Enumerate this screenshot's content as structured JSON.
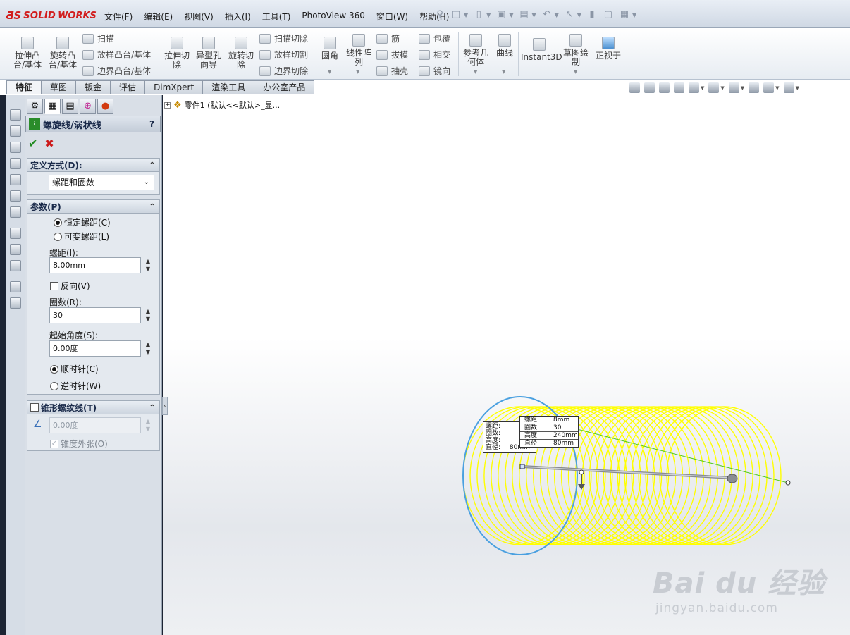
{
  "app": {
    "logo_ds": "ƋS",
    "logo_solid": "SOLID",
    "logo_works": "WORKS"
  },
  "menus": [
    "文件(F)",
    "编辑(E)",
    "视图(V)",
    "插入(I)",
    "工具(T)",
    "PhotoView 360",
    "窗口(W)",
    "帮助(H)"
  ],
  "ribbon": {
    "extrude_boss": "拉伸凸\n台/基体",
    "revolve_boss": "旋转凸\n台/基体",
    "sweep": "扫描",
    "loft_boss": "放样凸台/基体",
    "boundary_boss": "边界凸台/基体",
    "extrude_cut": "拉伸切\n除",
    "hole_wizard": "异型孔\n向导",
    "revolve_cut": "旋转切\n除",
    "sweep_cut": "扫描切除",
    "loft_cut": "放样切割",
    "boundary_cut": "边界切除",
    "fillet": "圆角",
    "linear_pattern": "线性阵\n列",
    "rib": "筋",
    "draft": "拔模",
    "shell": "抽壳",
    "wrap": "包覆",
    "intersect": "相交",
    "mirror": "镜向",
    "ref_geometry": "参考几\n何体",
    "curves": "曲线",
    "instant3d": "Instant3D",
    "sketch": "草图绘\n制",
    "normal_to": "正视于"
  },
  "tabs": [
    "特征",
    "草图",
    "钣金",
    "评估",
    "DimXpert",
    "渲染工具",
    "办公室产品"
  ],
  "pm": {
    "title": "螺旋线/涡状线",
    "help": "?",
    "definition": {
      "header": "定义方式(D):",
      "value": "螺距和圈数"
    },
    "params": {
      "header": "参数(P)",
      "constant_pitch": "恒定螺距(C)",
      "variable_pitch": "可变螺距(L)",
      "pitch_label": "螺距(I):",
      "pitch_value": "8.00mm",
      "reverse": "反向(V)",
      "revolutions_label": "圈数(R):",
      "revolutions_value": "30",
      "start_angle_label": "起始角度(S):",
      "start_angle_value": "0.00度",
      "clockwise": "顺时针(C)",
      "counterclockwise": "逆时针(W)"
    },
    "taper": {
      "header": "锥形螺纹线(T)",
      "angle_value": "0.00度",
      "taper_outward": "锥度外张(O)"
    }
  },
  "tree": {
    "root": "零件1  (默认<<默认>_显..."
  },
  "callout_back": {
    "rows": [
      "螺距:",
      "圈数:",
      "高度:",
      "直径:"
    ],
    "diameter": "80mm"
  },
  "callout_front": {
    "rows": [
      {
        "label": "螺距:",
        "value": "8mm"
      },
      {
        "label": "圈数:",
        "value": "30"
      },
      {
        "label": "高度:",
        "value": "240mm"
      },
      {
        "label": "直径:",
        "value": "80mm"
      }
    ]
  },
  "watermark": {
    "brand": "Bai du 经验",
    "url": "jingyan.baidu.com"
  },
  "colors": {
    "helix": "#ffff00",
    "circle": "#4aa0e0",
    "axis_line": "#55cc22",
    "accent_ok": "#1f8a1f",
    "accent_cancel": "#cc1a1a"
  }
}
